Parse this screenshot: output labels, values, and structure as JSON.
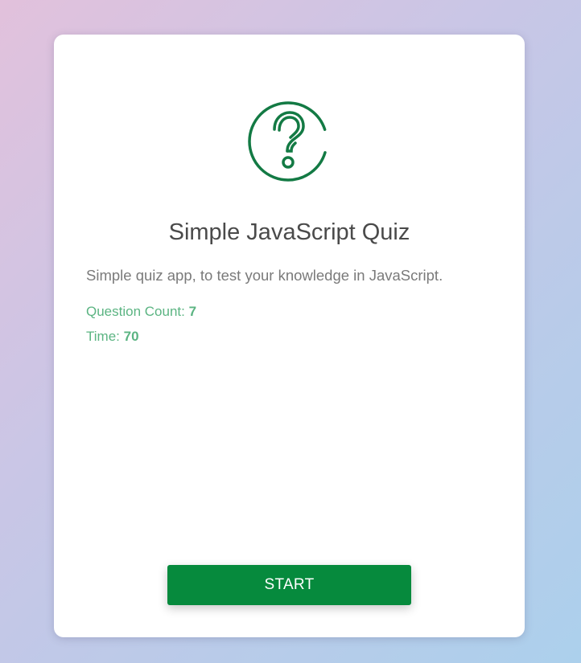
{
  "app": {
    "logo_icon": "question-circle-icon",
    "accent_color": "#137a44",
    "title": "Simple JavaScript Quiz",
    "description": "Simple quiz app, to test your knowledge in JavaScript."
  },
  "stats": {
    "question_count_label": "Question Count:",
    "question_count_value": "7",
    "time_label": "Time:",
    "time_value": "70"
  },
  "actions": {
    "start_label": "START",
    "start_color": "#068a3d"
  }
}
